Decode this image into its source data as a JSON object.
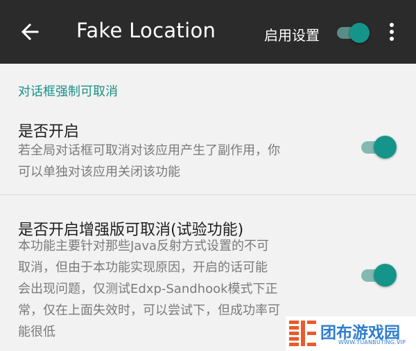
{
  "appbar": {
    "back_icon": "arrow-left-icon",
    "title": "Fake Location",
    "enable_label": "启用设置",
    "enable_on": true,
    "more_icon": "more-vert-icon"
  },
  "section": {
    "header": "对话框强制可取消",
    "items": [
      {
        "title": "是否开启",
        "desc_lines": [
          "若全局对话框可取消对该应用产生了副作用，你",
          "可以单独对该应用关闭该功能"
        ],
        "enabled": true
      },
      {
        "title": "是否开启增强版可取消(试验功能)",
        "desc_lines": [
          "本功能主要针对那些Java反射方式设置的不可",
          "取消，但由于本功能实现原因，开启的话可能",
          "会出现问题，仅测试Edxp-Sandhook模式下正",
          "常，仅在上面失效时，可以尝试下，但成功率可",
          "能很低"
        ],
        "enabled": true
      }
    ]
  },
  "colors": {
    "accent": "#15958a",
    "appbar_bg": "#2b2b2b",
    "background": "#f2f2f2"
  },
  "watermark": {
    "name": "团布游戏园",
    "url": "WWW.TUANBUTING.VIP"
  }
}
